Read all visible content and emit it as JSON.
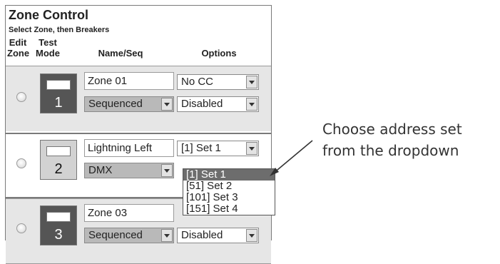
{
  "panel": {
    "title": "Zone Control",
    "subtitle": "Select Zone, then Breakers",
    "headers": {
      "edit_zone": "Edit Zone",
      "test_mode": "Test Mode",
      "name_seq": "Name/Seq",
      "options": "Options"
    }
  },
  "zones": [
    {
      "number": "1",
      "name": "Zone 01",
      "sequence": "Sequenced",
      "option_1": "No CC",
      "option_2": "Disabled",
      "test_style": "dark"
    },
    {
      "number": "2",
      "name": "Lightning Left",
      "sequence": "DMX",
      "option_1": "[1] Set 1",
      "option_2": "",
      "test_style": "light"
    },
    {
      "number": "3",
      "name": "Zone 03",
      "sequence": "Sequenced",
      "option_1": "",
      "option_2": "Disabled",
      "test_style": "dark"
    }
  ],
  "dropdown": {
    "options": [
      "[1] Set 1",
      "[51] Set 2",
      "[101] Set 3",
      "[151] Set 4"
    ],
    "selected": "[1] Set 1"
  },
  "callout": {
    "line1": "Choose address set",
    "line2": "from the dropdown"
  },
  "icons": {
    "radio": "radio-button-icon",
    "dropdown_arrow": "chevron-down-icon",
    "pointer": "arrow-icon"
  },
  "colors": {
    "selected_option_bg": "#6d6d6d",
    "row_shaded_bg": "#e6e6e6",
    "test_dark": "#555555",
    "test_light": "#d2d2d2"
  }
}
